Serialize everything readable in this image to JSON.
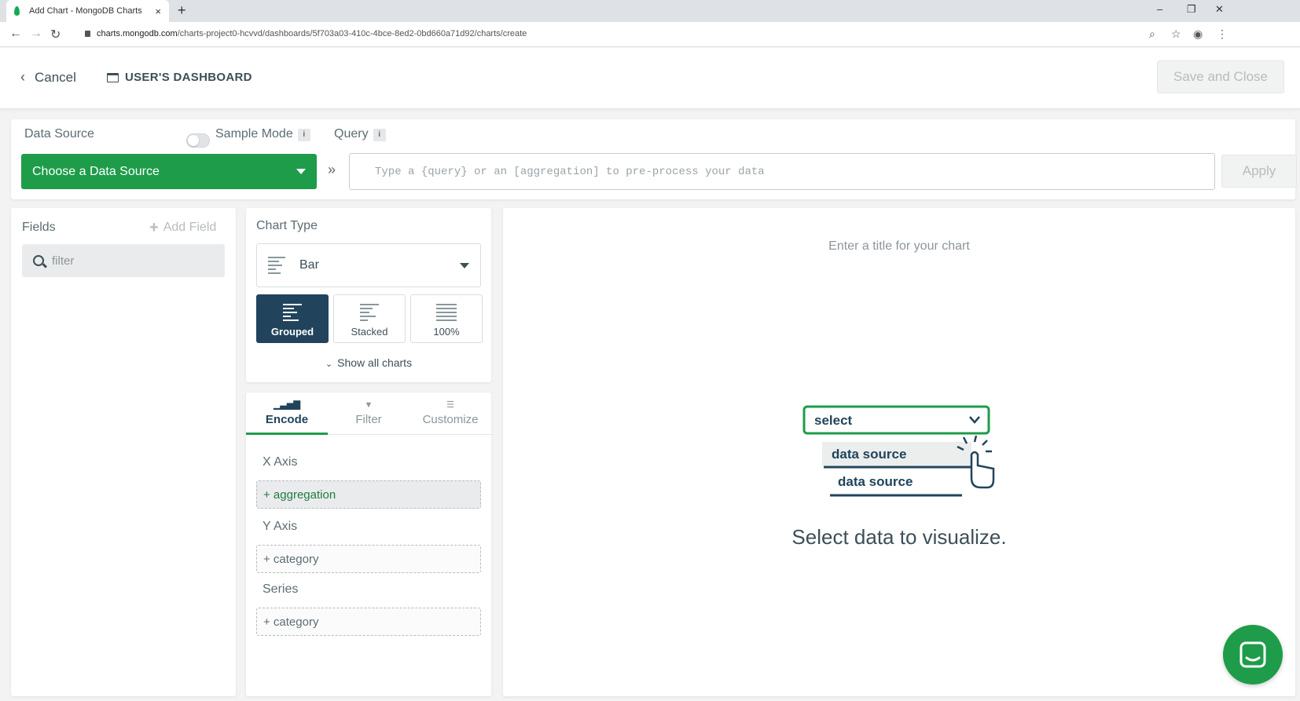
{
  "browser": {
    "tab_title": "Add Chart - MongoDB Charts",
    "tab_close": "×",
    "new_tab": "+",
    "url_domain": "charts.mongodb.com",
    "url_path": "/charts-project0-hcvvd/dashboards/5f703a03-410c-4bce-8ed2-0bd660a71d92/charts/create",
    "window_controls": [
      "–",
      "❐",
      "✕"
    ]
  },
  "header": {
    "cancel_label": "Cancel",
    "dashboard_label": "USER'S DASHBOARD",
    "save_label": "Save and Close"
  },
  "data_source": {
    "label": "Data Source",
    "sample_mode_label": "Sample Mode",
    "info_glyph": "i",
    "choose_label": "Choose a Data Source",
    "query_label": "Query",
    "query_placeholder": "Type a {query} or an [aggregation] to pre-process your data",
    "apply_label": "Apply"
  },
  "fields": {
    "title": "Fields",
    "add_label": "Add Field",
    "filter_placeholder": "filter"
  },
  "chart_type": {
    "title": "Chart Type",
    "selected": "Bar",
    "subtypes": [
      {
        "label": "Grouped",
        "active": true
      },
      {
        "label": "Stacked",
        "active": false
      },
      {
        "label": "100%",
        "active": false
      }
    ],
    "show_all_label": "Show all charts"
  },
  "encode": {
    "tabs": [
      {
        "label": "Encode",
        "active": true
      },
      {
        "label": "Filter",
        "active": false
      },
      {
        "label": "Customize",
        "active": false
      }
    ],
    "x_axis_label": "X Axis",
    "x_axis_zone": "+ aggregation",
    "y_axis_label": "Y Axis",
    "y_axis_zone": "+ category",
    "series_label": "Series",
    "series_zone": "+ category"
  },
  "chart": {
    "title_placeholder": "Enter a title for your chart",
    "illustration": {
      "select_label": "select",
      "option_1": "data source",
      "option_2": "data source"
    },
    "empty_message": "Select data to visualize."
  },
  "colors": {
    "brand_green": "#1e9c4a",
    "navy": "#21445c",
    "text": "#3d4f58"
  }
}
